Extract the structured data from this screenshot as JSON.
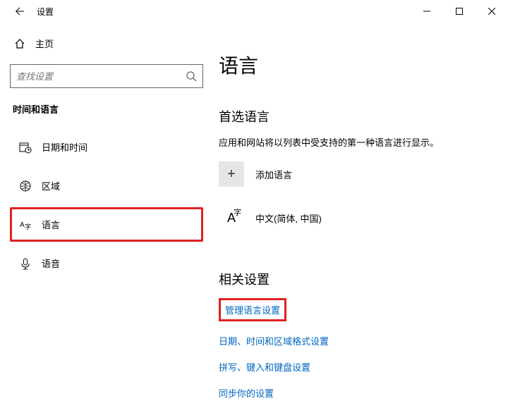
{
  "titlebar": {
    "title": "设置"
  },
  "sidebar": {
    "home": "主页",
    "search_placeholder": "查找设置",
    "section": "时间和语言",
    "items": [
      {
        "label": "日期和时间"
      },
      {
        "label": "区域"
      },
      {
        "label": "语言"
      },
      {
        "label": "语音"
      }
    ]
  },
  "main": {
    "heading": "语言",
    "preferred_title": "首选语言",
    "preferred_desc": "应用和网站将以列表中受支持的第一种语言进行显示。",
    "add_language": "添加语言",
    "languages": [
      {
        "label": "中文(简体, 中国)"
      }
    ],
    "related_title": "相关设置",
    "links": [
      "管理语言设置",
      "日期、时间和区域格式设置",
      "拼写、键入和键盘设置",
      "同步你的设置"
    ]
  }
}
